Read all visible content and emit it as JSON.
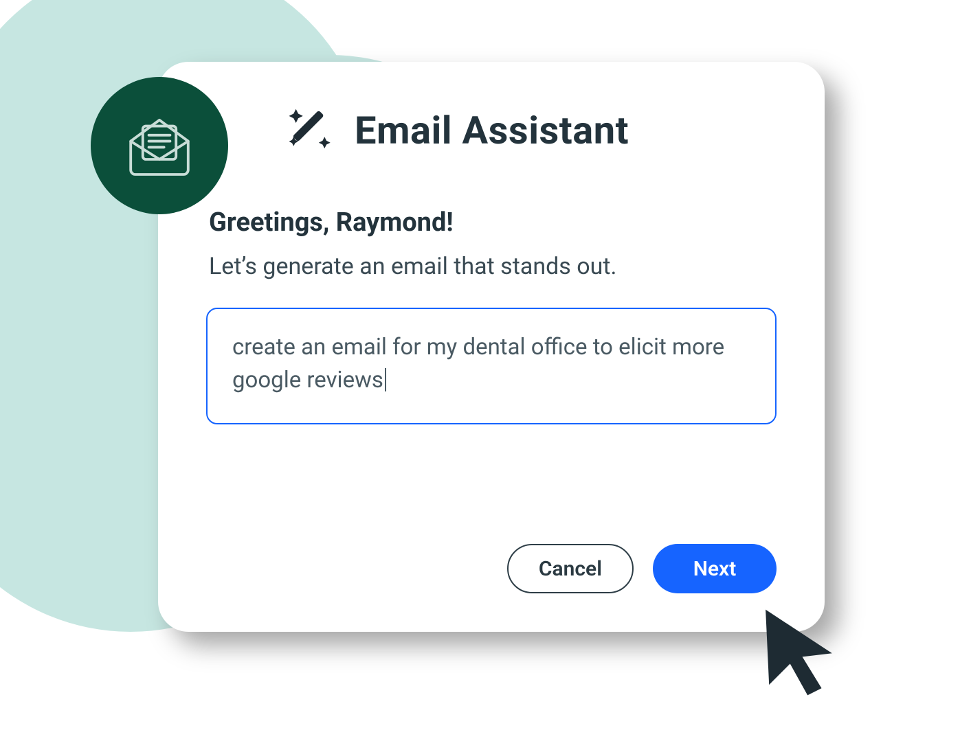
{
  "header": {
    "title": "Email Assistant"
  },
  "main": {
    "greeting": "Greetings, Raymond!",
    "subtitle": "Let’s generate an email that stands out.",
    "prompt_value": "create an email for my dental office to elicit more google reviews"
  },
  "buttons": {
    "cancel_label": "Cancel",
    "next_label": "Next"
  },
  "icons": {
    "badge": "open-envelope-icon",
    "title": "magic-wand-icon",
    "cursor": "cursor-arrow-icon"
  },
  "colors": {
    "accent": "#1664ff",
    "dark": "#1e2b33",
    "badge": "#0b4f3a",
    "mint": "#c6e6e1"
  }
}
